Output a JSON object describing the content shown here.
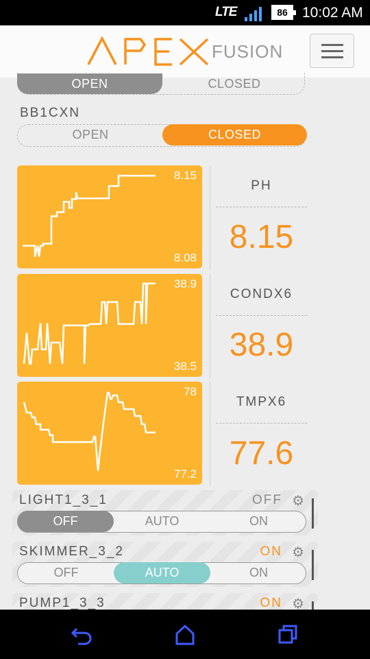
{
  "status_bar": {
    "network": "LTE",
    "battery": "86",
    "time": "10:02 AM"
  },
  "header": {
    "logo_main": "APEX",
    "logo_sub": "FUSION",
    "menu_icon": "hamburger-menu-icon"
  },
  "top_toggle": {
    "left": "OPEN",
    "right": "CLOSED",
    "selected": "OPEN"
  },
  "bb1cxn": {
    "label": "BB1CXN",
    "left": "OPEN",
    "right": "CLOSED",
    "selected": "CLOSED"
  },
  "probes": [
    {
      "name": "PH",
      "value": "8.15",
      "max": "8.15",
      "min": "8.08"
    },
    {
      "name": "CONDX6",
      "value": "38.9",
      "max": "38.9",
      "min": "38.5"
    },
    {
      "name": "TMPX6",
      "value": "77.6",
      "max": "78",
      "min": "77.2"
    }
  ],
  "outlets": [
    {
      "name": "LIGHT1_3_1",
      "state": "OFF",
      "state_color": "#8a8a8a",
      "options": [
        "OFF",
        "AUTO",
        "ON"
      ],
      "selected": "OFF"
    },
    {
      "name": "SKIMMER_3_2",
      "state": "ON",
      "state_color": "#f7931e",
      "options": [
        "OFF",
        "AUTO",
        "ON"
      ],
      "selected": "AUTO"
    },
    {
      "name": "PUMP1_3_3",
      "state": "ON",
      "state_color": "#f7931e"
    }
  ],
  "colors": {
    "accent": "#f7931e",
    "chart_bg": "#fdb42f",
    "auto_teal": "#86cfcc"
  },
  "nav": {
    "back_icon": "back-icon",
    "home_icon": "home-icon",
    "recents_icon": "recents-icon"
  }
}
